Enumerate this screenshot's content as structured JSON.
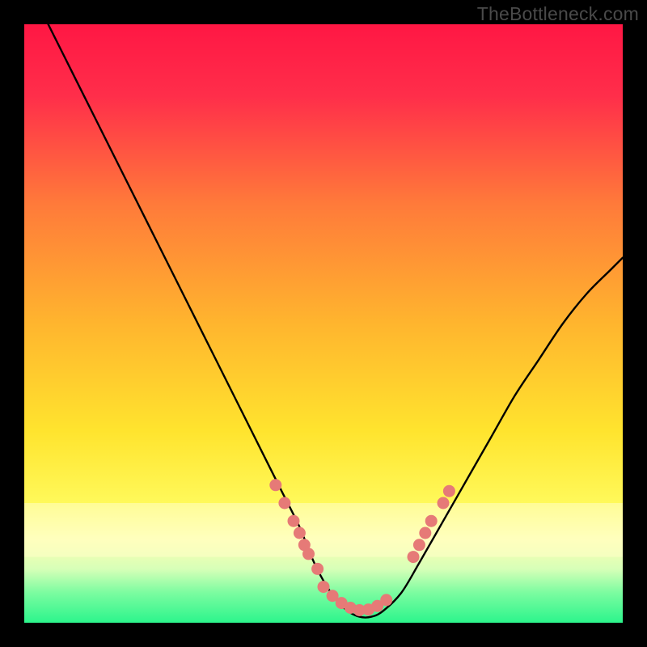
{
  "watermark": "TheBottleneck.com",
  "chart_data": {
    "type": "line",
    "title": "",
    "xlabel": "",
    "ylabel": "",
    "xlim": [
      0,
      100
    ],
    "ylim": [
      0,
      100
    ],
    "background": {
      "type": "vertical-gradient",
      "stops": [
        {
          "pos": 0.0,
          "color": "#ff1744"
        },
        {
          "pos": 0.12,
          "color": "#ff2e4a"
        },
        {
          "pos": 0.3,
          "color": "#ff7a3a"
        },
        {
          "pos": 0.5,
          "color": "#ffb52e"
        },
        {
          "pos": 0.68,
          "color": "#ffe42e"
        },
        {
          "pos": 0.8,
          "color": "#fff95a"
        },
        {
          "pos": 0.86,
          "color": "#ffffb0"
        },
        {
          "pos": 0.91,
          "color": "#d7ffb8"
        },
        {
          "pos": 0.95,
          "color": "#7bfca0"
        },
        {
          "pos": 1.0,
          "color": "#2cf58c"
        }
      ]
    },
    "series": [
      {
        "name": "curve",
        "type": "line",
        "color": "#000000",
        "x": [
          4,
          8,
          12,
          16,
          20,
          24,
          28,
          32,
          36,
          40,
          43,
          46,
          48,
          50,
          52,
          54,
          56,
          58,
          60,
          63,
          66,
          70,
          74,
          78,
          82,
          86,
          90,
          94,
          98,
          100
        ],
        "y": [
          100,
          92,
          84,
          76,
          68,
          60,
          52,
          44,
          36,
          28,
          22,
          16,
          11,
          7,
          4,
          2,
          1,
          1,
          2,
          5,
          10,
          17,
          24,
          31,
          38,
          44,
          50,
          55,
          59,
          61
        ]
      },
      {
        "name": "markers-left",
        "type": "scatter",
        "color": "#e67a77",
        "x": [
          42,
          43.5,
          45,
          46,
          46.8,
          47.5,
          49
        ],
        "y": [
          23,
          20,
          17,
          15,
          13,
          11.5,
          9
        ]
      },
      {
        "name": "markers-bottom",
        "type": "scatter",
        "color": "#e67a77",
        "x": [
          50,
          51.5,
          53,
          54.5,
          56,
          57.5,
          59,
          60.5
        ],
        "y": [
          6,
          4.5,
          3.3,
          2.5,
          2.1,
          2.2,
          2.8,
          3.8
        ]
      },
      {
        "name": "markers-right",
        "type": "scatter",
        "color": "#e67a77",
        "x": [
          65,
          66,
          67,
          68,
          70,
          71
        ],
        "y": [
          11,
          13,
          15,
          17,
          20,
          22
        ]
      }
    ]
  }
}
